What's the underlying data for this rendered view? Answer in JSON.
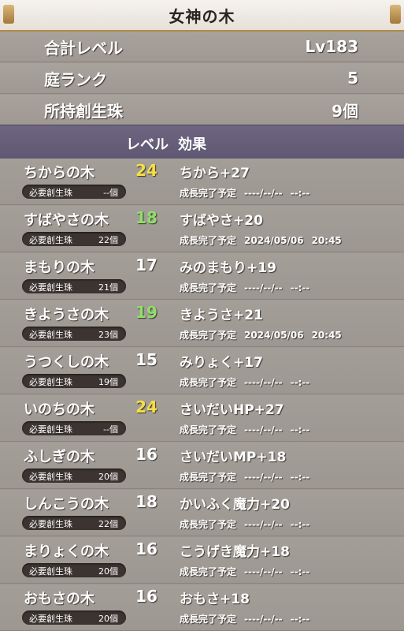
{
  "header": {
    "title": "女神の木"
  },
  "summary": [
    {
      "label": "合計レベル",
      "value": "Lv183"
    },
    {
      "label": "庭ランク",
      "value": "5"
    },
    {
      "label": "所持創生珠",
      "value": "9個"
    }
  ],
  "columns": {
    "level": "レベル",
    "effect": "効果"
  },
  "need_label": "必要創生珠",
  "complete_label": "成長完了予定",
  "trees": [
    {
      "name": "ちからの木",
      "level": "24",
      "level_color": "gold",
      "effect": "ちから+27",
      "need": "--個",
      "date": "----/--/--",
      "time": "--:--"
    },
    {
      "name": "すばやさの木",
      "level": "18",
      "level_color": "green",
      "effect": "すばやさ+20",
      "need": "22個",
      "date": "2024/05/06",
      "time": "20:45"
    },
    {
      "name": "まもりの木",
      "level": "17",
      "level_color": "white",
      "effect": "みのまもり+19",
      "need": "21個",
      "date": "----/--/--",
      "time": "--:--"
    },
    {
      "name": "きようさの木",
      "level": "19",
      "level_color": "green",
      "effect": "きようさ+21",
      "need": "23個",
      "date": "2024/05/06",
      "time": "20:45"
    },
    {
      "name": "うつくしの木",
      "level": "15",
      "level_color": "white",
      "effect": "みりょく+17",
      "need": "19個",
      "date": "----/--/--",
      "time": "--:--"
    },
    {
      "name": "いのちの木",
      "level": "24",
      "level_color": "gold",
      "effect": "さいだいHP+27",
      "need": "--個",
      "date": "----/--/--",
      "time": "--:--"
    },
    {
      "name": "ふしぎの木",
      "level": "16",
      "level_color": "white",
      "effect": "さいだいMP+18",
      "need": "20個",
      "date": "----/--/--",
      "time": "--:--"
    },
    {
      "name": "しんこうの木",
      "level": "18",
      "level_color": "white",
      "effect": "かいふく魔力+20",
      "need": "22個",
      "date": "----/--/--",
      "time": "--:--"
    },
    {
      "name": "まりょくの木",
      "level": "16",
      "level_color": "white",
      "effect": "こうげき魔力+18",
      "need": "20個",
      "date": "----/--/--",
      "time": "--:--"
    },
    {
      "name": "おもさの木",
      "level": "16",
      "level_color": "white",
      "effect": "おもさ+18",
      "need": "20個",
      "date": "----/--/--",
      "time": "--:--"
    }
  ]
}
